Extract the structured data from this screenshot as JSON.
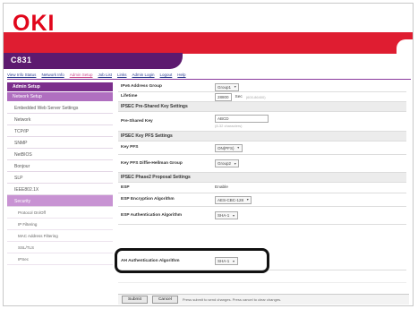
{
  "brand": {
    "logo_text": "OKI",
    "device_name": "C831"
  },
  "colors": {
    "brand_red": "#df1d31",
    "brand_purple": "#5d1a6f",
    "accent_pink": "#c893d3"
  },
  "top_nav": [
    {
      "label": "View Info Status"
    },
    {
      "label": "Network Info"
    },
    {
      "label": "Admin Setup"
    },
    {
      "label": "Job List"
    },
    {
      "label": "Links"
    },
    {
      "label": "Admin Login"
    },
    {
      "label": "Logout"
    },
    {
      "label": "Help"
    }
  ],
  "sidebar": {
    "header": "Admin Setup",
    "section": "Network Setup",
    "items": [
      {
        "label": "Embedded Web Server Settings"
      },
      {
        "label": "Network"
      },
      {
        "label": "TCP/IP"
      },
      {
        "label": "SNMP"
      },
      {
        "label": "NetBIOS"
      },
      {
        "label": "Bonjour"
      },
      {
        "label": "SLP"
      },
      {
        "label": "IEEE802.1X"
      },
      {
        "label": "Security"
      }
    ],
    "sub_items": [
      {
        "label": "Protocol On/Off"
      },
      {
        "label": "IP Filtering"
      },
      {
        "label": "MAC Address Filtering"
      },
      {
        "label": "SSL/TLS"
      },
      {
        "label": "IPSec"
      }
    ]
  },
  "form": {
    "rows": [
      {
        "label": "IPv6 Address Group",
        "value": "Group1"
      },
      {
        "label": "Lifetime",
        "value": "28800",
        "unit": "Sec",
        "hint": "(600-86400)"
      },
      {
        "section": "IPSEC Pre-Shared Key Settings"
      },
      {
        "label": "Pre-Shared Key",
        "value": "ABCD",
        "hint": "(8-32 characters)"
      },
      {
        "section": "IPSEC Key PFS Settings"
      },
      {
        "label": "Key PFS",
        "value": "ON(PFS)"
      },
      {
        "label": "Key PFS Diffie-Hellman Group",
        "value": "Group2"
      },
      {
        "section": "IPSEC Phase2 Proposal Settings"
      },
      {
        "label": "ESP",
        "value": "Enable"
      },
      {
        "label": "ESP Encryption Algorithm",
        "value": "AES-CBC-128"
      },
      {
        "label": "ESP Authentication Algorithm",
        "value": "SHA-1"
      },
      {
        "label": "AH Authentication Algorithm",
        "value": "SHA-1"
      }
    ]
  },
  "footer": {
    "submit_label": "Submit",
    "cancel_label": "Cancel",
    "note": "Press submit to send changes. Press cancel to clear changes."
  }
}
